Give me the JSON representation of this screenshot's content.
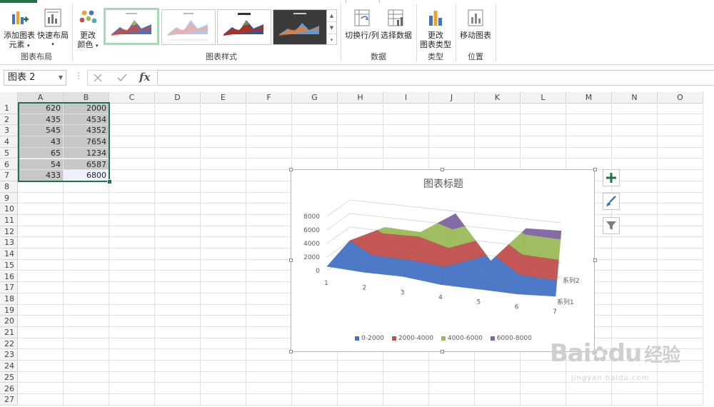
{
  "ribbon": {
    "groups": {
      "layout": {
        "add_element": "添加图表",
        "add_element_line2": "元素",
        "quick_layout": "快速布局",
        "label": "图表布局"
      },
      "change_color": {
        "line1": "更改",
        "line2": "颜色"
      },
      "styles_label": "图表样式",
      "data": {
        "switch": "切换行/列",
        "select": "选择数据",
        "label": "数据"
      },
      "type": {
        "line1": "更改",
        "line2": "图表类型",
        "label": "类型"
      },
      "location": {
        "move": "移动图表",
        "label": "位置"
      }
    }
  },
  "formula_bar": {
    "name_box": "图表 2",
    "fx": "fx",
    "value": ""
  },
  "columns": [
    "A",
    "B",
    "C",
    "D",
    "E",
    "F",
    "G",
    "H",
    "I",
    "J",
    "K",
    "L",
    "M",
    "N",
    "O"
  ],
  "rows": [
    "1",
    "2",
    "3",
    "4",
    "5",
    "6",
    "7",
    "8",
    "9",
    "10",
    "11",
    "12",
    "13",
    "14",
    "15",
    "16",
    "17",
    "18",
    "19",
    "20",
    "21",
    "22",
    "23",
    "24",
    "25",
    "26",
    "27"
  ],
  "cells": {
    "A": [
      "620",
      "435",
      "545",
      "43",
      "65",
      "54",
      "433"
    ],
    "B": [
      "2000",
      "4534",
      "4352",
      "7654",
      "1234",
      "6587",
      "6800"
    ]
  },
  "colors": {
    "excel_green": "#217346",
    "c1": "#4472c4",
    "c2": "#c0504d",
    "c3": "#9bbb59",
    "c4": "#8064a2"
  },
  "chart": {
    "title": "图表标题",
    "z_ticks": [
      "8000",
      "6000",
      "4000",
      "2000",
      "0"
    ],
    "x_ticks": [
      "1",
      "2",
      "3",
      "4",
      "5",
      "6",
      "7"
    ],
    "series_labels": [
      "系列2",
      "系列1"
    ],
    "legend": [
      "0-2000",
      "2000-4000",
      "4000-6000",
      "6000-8000"
    ]
  },
  "chart_data": {
    "type": "surface",
    "title": "图表标题",
    "categories": [
      "1",
      "2",
      "3",
      "4",
      "5",
      "6",
      "7"
    ],
    "series": [
      {
        "name": "系列1",
        "values": [
          620,
          435,
          545,
          43,
          65,
          54,
          433
        ]
      },
      {
        "name": "系列2",
        "values": [
          2000,
          4534,
          4352,
          7654,
          1234,
          6587,
          6800
        ]
      }
    ],
    "zlim": [
      0,
      8000
    ],
    "bands": [
      "0-2000",
      "2000-4000",
      "4000-6000",
      "6000-8000"
    ],
    "legend_position": "bottom"
  },
  "watermark": {
    "brand": "Bai",
    "brand2": "du",
    "cn": "经验",
    "url": "jingyan.baidu.com"
  }
}
